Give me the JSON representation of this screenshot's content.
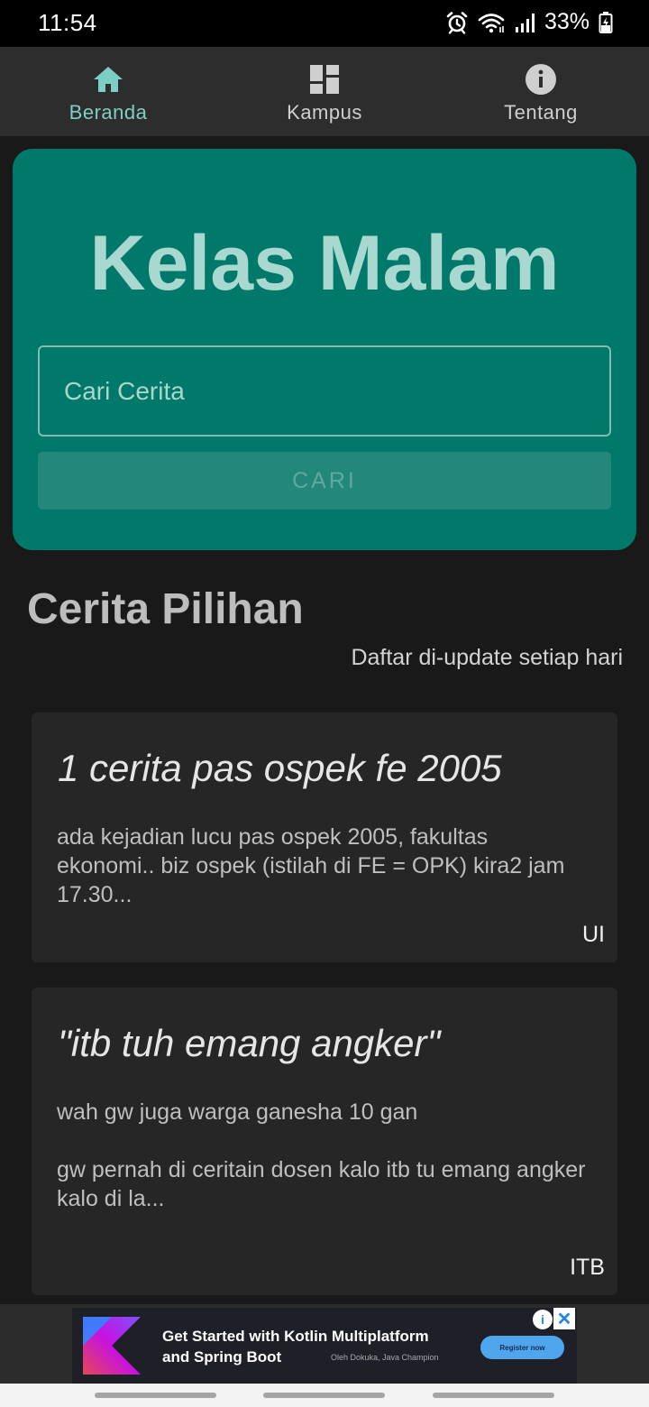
{
  "status_bar": {
    "time": "11:54",
    "battery": "33%",
    "icons": [
      "alarm-icon",
      "wifi-icon",
      "signal-icon",
      "battery-charging-icon"
    ]
  },
  "nav": {
    "items": [
      {
        "label": "Beranda",
        "icon": "home-icon",
        "active": true
      },
      {
        "label": "Kampus",
        "icon": "dashboard-icon",
        "active": false
      },
      {
        "label": "Tentang",
        "icon": "info-icon",
        "active": false
      }
    ],
    "colors": {
      "active": "#7ecfc3",
      "inactive": "#cfcfcf"
    }
  },
  "hero": {
    "title": "Kelas Malam",
    "search_placeholder": "Cari Cerita",
    "search_button": "CARI",
    "background": "#00796b"
  },
  "section": {
    "title": "Cerita Pilihan",
    "subtitle": "Daftar di-update setiap hari"
  },
  "stories": [
    {
      "title": "1 cerita pas ospek fe 2005",
      "excerpt": "ada kejadian lucu pas ospek 2005, fakultas ekonomi.. biz ospek (istilah di FE = OPK) kira2 jam 17.30...",
      "campus": "UI"
    },
    {
      "title": "\"itb tuh emang angker\"",
      "excerpt": "wah gw juga warga ganesha 10 gan\n\ngw pernah di ceritain dosen kalo itb tu emang angker\nkalo di la...",
      "campus": "ITB"
    }
  ],
  "ad": {
    "line1": "Get Started with Kotlin Multiplatform",
    "line2": "and Spring Boot",
    "author": "Oleh Dokuka, Java Champion",
    "cta": "Register now",
    "info_glyph": "i",
    "close_glyph": "✕"
  }
}
